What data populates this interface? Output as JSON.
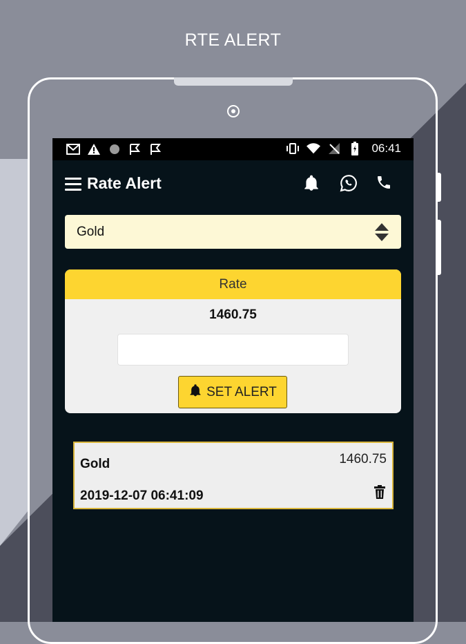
{
  "headline": "RTE ALERT",
  "status_bar": {
    "time": "06:41",
    "left_icons": [
      "gmail-icon",
      "warning-icon",
      "circle-icon",
      "flag-icon",
      "flag-icon"
    ],
    "right_icons": [
      "vibrate-icon",
      "wifi-icon",
      "no-signal-icon",
      "battery-icon"
    ]
  },
  "toolbar": {
    "title": "Rate Alert",
    "icons": [
      "bell-icon",
      "whatsapp-icon",
      "phone-icon"
    ]
  },
  "commodity_select": {
    "selected": "Gold"
  },
  "rate_card": {
    "header": "Rate",
    "current_rate": "1460.75",
    "input_value": "",
    "set_alert_label": "SET ALERT"
  },
  "alerts": [
    {
      "name": "Gold",
      "rate": "1460.75",
      "timestamp": "2019-12-07 06:41:09"
    }
  ],
  "colors": {
    "accent": "#fdd530",
    "screen_bg": "#06131a",
    "select_bg": "#fdf8d6",
    "card_bg": "#f0f0f0"
  }
}
